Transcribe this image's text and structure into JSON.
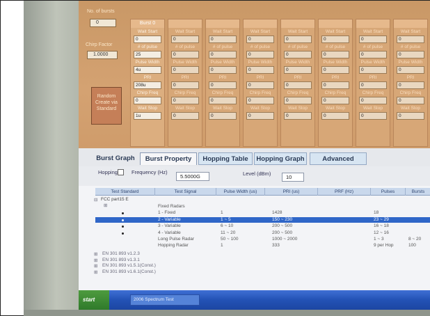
{
  "left_panel": {
    "top_label": "No. of bursts",
    "top_value": "0",
    "chirp_factor_label": "Chirp Factor",
    "chirp_factor_value": "1.0000",
    "random_button": "Random Create via Standard"
  },
  "bursts": [
    {
      "header": "Burst 0",
      "wait_start": "0",
      "num_pulse": "25",
      "pulse_width": "4u",
      "pri": "208u",
      "chirp_freq": "0",
      "wait_stop": "1u"
    },
    {
      "header": "",
      "wait_start": "0",
      "num_pulse": "0",
      "pulse_width": "0",
      "pri": "0",
      "chirp_freq": "0",
      "wait_stop": "0"
    },
    {
      "header": "",
      "wait_start": "0",
      "num_pulse": "0",
      "pulse_width": "0",
      "pri": "0",
      "chirp_freq": "0",
      "wait_stop": "0"
    },
    {
      "header": "",
      "wait_start": "0",
      "num_pulse": "0",
      "pulse_width": "0",
      "pri": "0",
      "chirp_freq": "0",
      "wait_stop": "0"
    },
    {
      "header": "",
      "wait_start": "0",
      "num_pulse": "0",
      "pulse_width": "0",
      "pri": "0",
      "chirp_freq": "0",
      "wait_stop": "0"
    },
    {
      "header": "",
      "wait_start": "0",
      "num_pulse": "0",
      "pulse_width": "0",
      "pri": "0",
      "chirp_freq": "0",
      "wait_stop": "0"
    },
    {
      "header": "",
      "wait_start": "0",
      "num_pulse": "0",
      "pulse_width": "0",
      "pri": "0",
      "chirp_freq": "0",
      "wait_stop": "0"
    },
    {
      "header": "",
      "wait_start": "0",
      "num_pulse": "0",
      "pulse_width": "0",
      "pri": "0",
      "chirp_freq": "0",
      "wait_stop": "0"
    }
  ],
  "field_labels": {
    "wait_start": "Wait Start",
    "num_pulse": "# of pulse",
    "pulse_width": "Pulse Width",
    "pri": "PRI",
    "chirp_freq": "Chirp Freq",
    "wait_stop": "Wait Stop"
  },
  "tabs": [
    "Burst Graph",
    "Burst Property",
    "Hopping Table",
    "Hopping Graph",
    "Advanced"
  ],
  "options": {
    "hopping_label": "Hopping",
    "frequency_label": "Frequency (Hz)",
    "frequency_value": "5.5000G",
    "level_label": "Level (dBm)",
    "level_value": "10"
  },
  "table": {
    "headers": [
      "Test Standard",
      "Test Signal",
      "Pulse Width (us)",
      "PRI (us)",
      "PRF (Hz)",
      "Pulses",
      "Bursts"
    ],
    "group_label": "FCC part15 E",
    "rows": [
      {
        "signal": "Fixed Radars",
        "pw": "",
        "pri": "",
        "prf": "",
        "pulses": "",
        "bursts": ""
      },
      {
        "signal": "1 - Fixed",
        "pw": "1",
        "pri": "1428",
        "prf": "",
        "pulses": "18",
        "bursts": ""
      },
      {
        "signal": "2 - Variable",
        "pw": "1 ~ 5",
        "pri": "150 ~ 230",
        "prf": "",
        "pulses": "23 ~ 29",
        "bursts": ""
      },
      {
        "signal": "3 - Variable",
        "pw": "6 ~ 10",
        "pri": "200 ~ 500",
        "prf": "",
        "pulses": "16 ~ 18",
        "bursts": ""
      },
      {
        "signal": "4 - Variable",
        "pw": "11 ~ 20",
        "pri": "200 ~ 500",
        "prf": "",
        "pulses": "12 ~ 16",
        "bursts": ""
      },
      {
        "signal": "Long Pulse Radar",
        "pw": "50 ~ 100",
        "pri": "1000 ~ 2000",
        "prf": "",
        "pulses": "1 ~ 3",
        "bursts": "8 ~ 20"
      },
      {
        "signal": "Hopping Radar",
        "pw": "1",
        "pri": "333",
        "prf": "",
        "pulses": "9 per Hop",
        "bursts": "100"
      }
    ],
    "other_standards": [
      "EN 301 893 v1.2.3",
      "EN 301 893 v1.3.1",
      "EN 301 893 v1.5.1(Const.)",
      "EN 301 893 v1.6.1(Const.)"
    ]
  },
  "taskbar": {
    "start_label": "start",
    "task_label": "2006 Spectrum Test"
  },
  "colors": {
    "panel_orange": "#d4a272",
    "selected_row": "#2f66c8",
    "taskbar_blue": "#2352b5"
  }
}
